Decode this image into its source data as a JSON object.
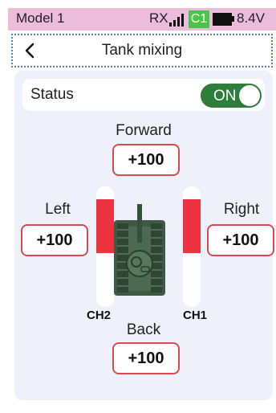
{
  "statusbar": {
    "model": "Model 1",
    "rx": "RX",
    "channel_badge": "C1",
    "voltage": "8.4V",
    "icons": [
      "signal-icon",
      "battery-icon"
    ]
  },
  "header": {
    "title": "Tank mixing",
    "back_icon": "chevron-left-icon"
  },
  "status": {
    "label": "Status",
    "toggle_text": "ON",
    "toggle_color": "#2e7d3a"
  },
  "forward": {
    "label": "Forward",
    "value": "+100"
  },
  "left": {
    "label": "Left",
    "value": "+100"
  },
  "right": {
    "label": "Right",
    "value": "+100"
  },
  "back": {
    "label": "Back",
    "value": "+100"
  },
  "channels": {
    "ch1": {
      "label": "CH1",
      "level_fraction": 0.5
    },
    "ch2": {
      "label": "CH2",
      "level_fraction": 0.5
    }
  },
  "colors": {
    "statusbar_bg": "#ecbcdc",
    "badge": "#49c64a",
    "accent_red": "#ee3340",
    "panel_bg": "#eef1fa"
  }
}
